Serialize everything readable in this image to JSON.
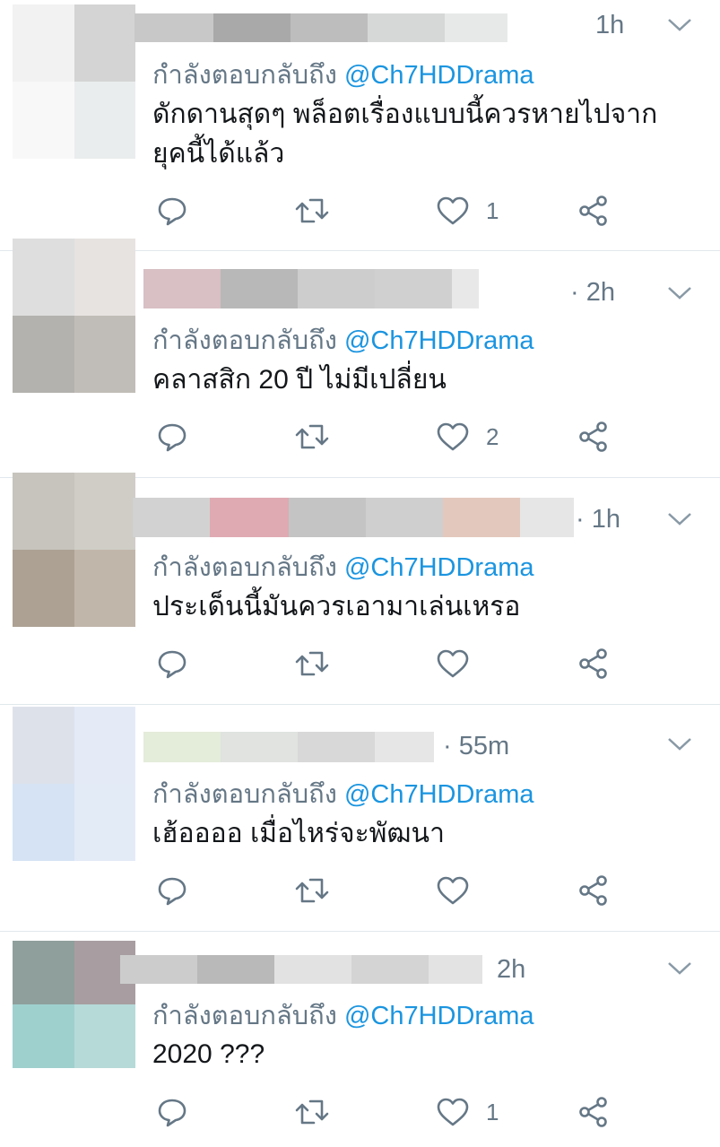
{
  "colors": {
    "secondary_text": "#657786",
    "link": "#1b95e0",
    "divider": "#e1e8ed",
    "icon": "#657786"
  },
  "icons": [
    "reply-icon",
    "retweet-icon",
    "like-icon",
    "share-icon",
    "chevron-down-icon"
  ],
  "tweets": [
    {
      "time": "1h",
      "reply_label": "กำลังตอบกลับถึง",
      "reply_handle": "@Ch7HDDrama",
      "text": "ดักดานสุดๆ พล็อตเรื่องแบบนี้ควรหายไปจากยุคนี้ได้แล้ว",
      "likes": "1"
    },
    {
      "time": "· 2h",
      "reply_label": "กำลังตอบกลับถึง",
      "reply_handle": "@Ch7HDDrama",
      "text": "คลาสสิก 20 ปี ไม่มีเปลี่ยน",
      "likes": "2"
    },
    {
      "time": "· 1h",
      "reply_label": "กำลังตอบกลับถึง",
      "reply_handle": "@Ch7HDDrama",
      "text": "ประเด็นนี้มันควรเอามาเล่นเหรอ",
      "likes": ""
    },
    {
      "time": "· 55m",
      "reply_label": "กำลังตอบกลับถึง",
      "reply_handle": "@Ch7HDDrama",
      "text": "เฮ้ออออ เมื่อไหร่จะพัฒนา",
      "likes": ""
    },
    {
      "time": "2h",
      "reply_label": "กำลังตอบกลับถึง",
      "reply_handle": "@Ch7HDDrama",
      "text": "2020 ???",
      "likes": "1"
    }
  ]
}
